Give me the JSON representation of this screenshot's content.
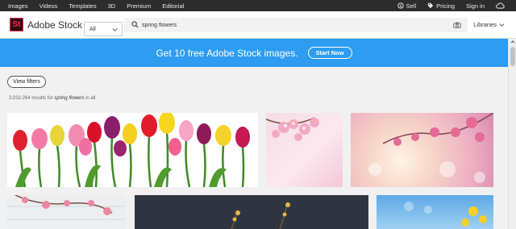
{
  "top_nav": {
    "left_items": [
      "Images",
      "Videos",
      "Templates",
      "3D",
      "Premium",
      "Editorial"
    ],
    "sell": "Sell",
    "pricing": "Pricing",
    "sign_in": "Sign in"
  },
  "header": {
    "logo_text": "St",
    "brand": "Adobe Stock",
    "category": "All",
    "search_value": "spring flowers",
    "libraries": "Libraries"
  },
  "banner": {
    "text": "Get 10 free Adobe Stock images.",
    "button": "Start Now"
  },
  "filters": {
    "view_filters": "View filters"
  },
  "results": {
    "count": "3,032,264",
    "results_for": "results for",
    "query": "spring flowers",
    "in_all": "in all"
  },
  "colors": {
    "banner_blue": "#2d9cf1",
    "nav_dark": "#2c2c2c",
    "logo_red": "#ff2d4b"
  }
}
